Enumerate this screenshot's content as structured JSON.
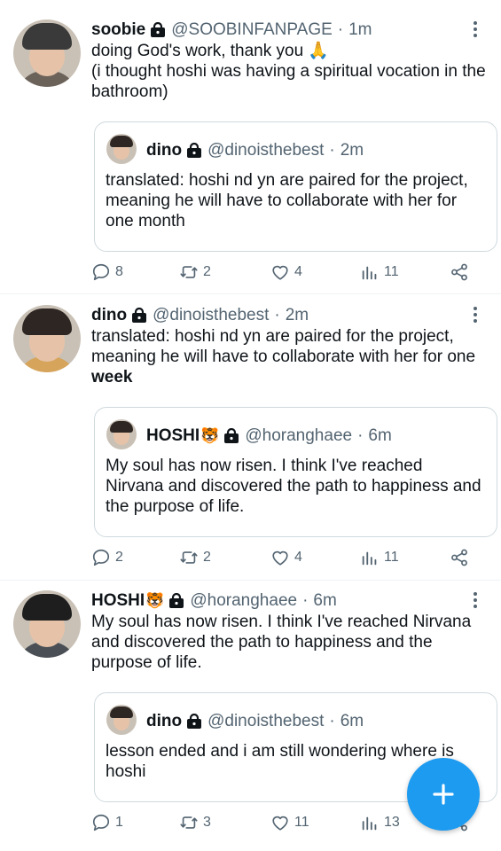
{
  "tweets": [
    {
      "name": "soobie",
      "lock_icon": "lock-icon",
      "handle": "@SOOBINFANPAGE",
      "dot": "·",
      "time": "1m",
      "body": "doing God's work, thank you 🙏\n(i thought hoshi was having a spiritual vocation in the bathroom)",
      "quote": {
        "name": "dino",
        "handle": "@dinoisthebest",
        "dot": "·",
        "time": "2m",
        "body": "translated: hoshi nd yn are paired for the project, meaning he will have to collaborate with her for one month"
      },
      "replies": "8",
      "retweets": "2",
      "likes": "4",
      "views": "11"
    },
    {
      "name": "dino",
      "lock_icon": "lock-icon",
      "handle": "@dinoisthebest",
      "dot": "·",
      "time": "2m",
      "body": "translated: hoshi nd yn are paired for the project, meaning he will have to collaborate with her for one ",
      "body_bold": "week",
      "quote": {
        "name": "HOSHI",
        "emoji": "🐯",
        "handle": "@horanghaee",
        "dot": "·",
        "time": "6m",
        "body": "My soul has now risen. I think I've reached Nirvana and discovered the path to happiness and the purpose of life."
      },
      "replies": "2",
      "retweets": "2",
      "likes": "4",
      "views": "11"
    },
    {
      "name": "HOSHI",
      "emoji": "🐯",
      "lock_icon": "lock-icon",
      "handle": "@horanghaee",
      "dot": "·",
      "time": "6m",
      "body": "My soul has now risen. I think I've reached Nirvana and discovered the path to happiness and the purpose of life.",
      "quote": {
        "name": "dino",
        "handle": "@dinoisthebest",
        "dot": "·",
        "time": "6m",
        "body": "lesson ended and i am still wondering where is hoshi"
      },
      "replies": "1",
      "retweets": "3",
      "likes": "11",
      "views": "13"
    }
  ],
  "fab": {
    "icon": "plus-icon",
    "color": "#1d9bf0"
  },
  "colors": {
    "muted": "#536471",
    "text": "#0f1419",
    "border": "#cfd9de",
    "accent": "#1d9bf0"
  }
}
